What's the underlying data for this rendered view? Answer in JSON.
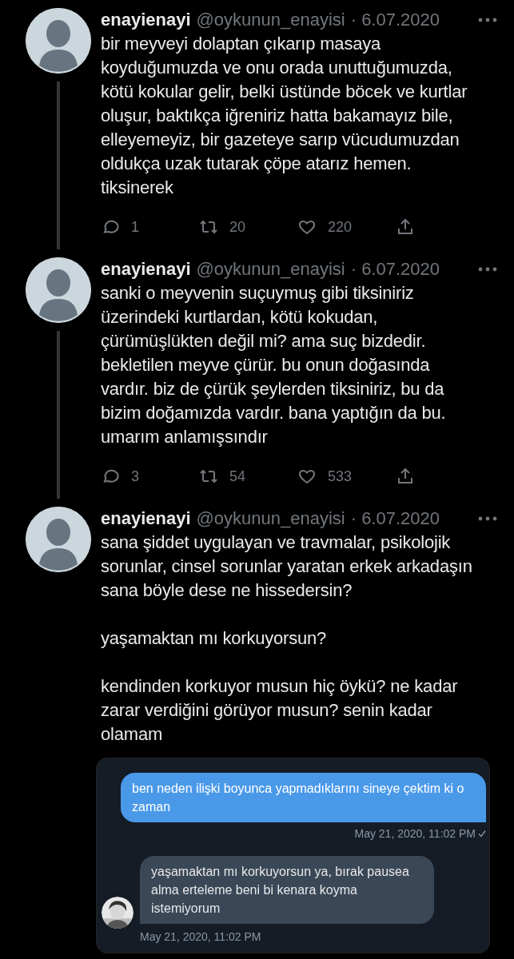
{
  "tweets": [
    {
      "name": "enayienayi",
      "handle": "@oykunun_enayisi",
      "date": "· 6.07.2020",
      "thread_line": true,
      "paragraphs": [
        "bir meyveyi dolaptan çıkarıp masaya koyduğumuzda ve onu orada unuttuğumuzda, kötü kokular gelir, belki üstünde böcek ve kurtlar oluşur, baktıkça iğreniriz hatta bakamayız bile, elleyemeyiz, bir gazeteye sarıp vücudumuzdan oldukça uzak tutarak çöpe atarız hemen. tiksinerek"
      ],
      "actions": {
        "replies": "1",
        "retweets": "20",
        "likes": "220"
      }
    },
    {
      "name": "enayienayi",
      "handle": "@oykunun_enayisi",
      "date": "· 6.07.2020",
      "thread_line": true,
      "paragraphs": [
        "sanki o meyvenin suçuymuş gibi tiksiniriz üzerindeki kurtlardan, kötü kokudan, çürümüşlükten değil mi? ama suç bizdedir. bekletilen meyve çürür. bu onun doğasında vardır. biz de çürük şeylerden tiksiniriz, bu da bizim doğamızda vardır. bana yaptığın da bu. umarım anlamışsındır"
      ],
      "actions": {
        "replies": "3",
        "retweets": "54",
        "likes": "533"
      }
    },
    {
      "name": "enayienayi",
      "handle": "@oykunun_enayisi",
      "date": "· 6.07.2020",
      "thread_line": false,
      "paragraphs": [
        "sana şiddet uygulayan ve travmalar, psikolojik sorunlar, cinsel sorunlar yaratan erkek arkadaşın sana böyle dese ne hissedersin?",
        "yaşamaktan mı korkuyorsun?",
        "kendinden korkuyor musun hiç öykü? ne kadar zarar verdiğini görüyor musun? senin kadar olamam"
      ],
      "attachment": {
        "messages": [
          {
            "kind": "sent",
            "text": "ben neden ilişki boyunca yapmadıklarını sineye çektim ki o zaman",
            "time": "May 21, 2020, 11:02 PM",
            "read": true
          },
          {
            "kind": "received",
            "text": "yaşamaktan mı korkuyorsun ya, bırak pausea alma erteleme beni bi kenara koyma istemiyorum",
            "time": "May 21, 2020, 11:02 PM"
          }
        ]
      }
    }
  ]
}
